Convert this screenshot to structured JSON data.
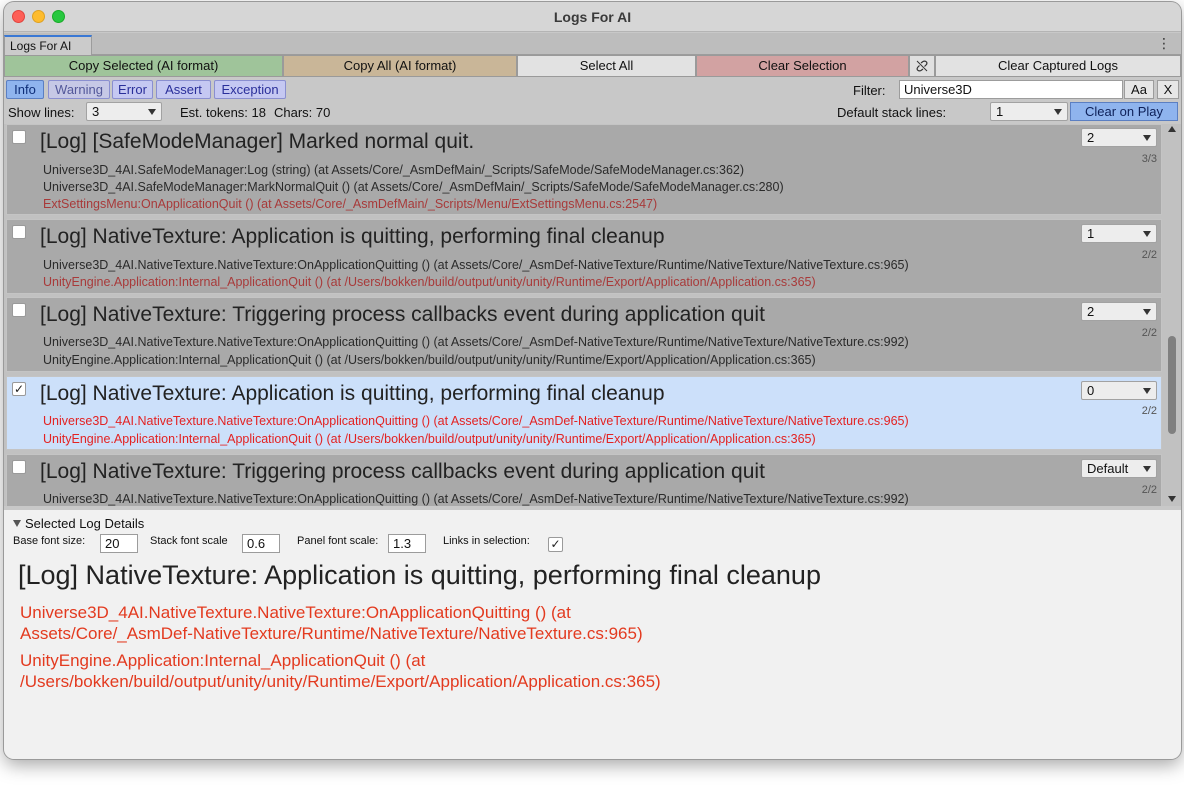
{
  "window": {
    "title": "Logs For AI"
  },
  "tab": {
    "label": "Logs For AI",
    "menu_icon": "kebab-menu-icon"
  },
  "actions": {
    "copy_selected": "Copy Selected (AI format)",
    "copy_all": "Copy All (AI format)",
    "select_all": "Select All",
    "clear_selection": "Clear Selection",
    "link_icon": "unlink-icon",
    "clear_captured": "Clear Captured Logs"
  },
  "colors": {
    "copy_selected_bg": "#9fc49a",
    "copy_all_bg": "#c9b698",
    "clear_selection_bg": "#d2a2a2",
    "accent": "#8fb4ee",
    "stack_red": "#e32222",
    "selected_row": "#cce0fa"
  },
  "levels": {
    "info": "Info",
    "warning": "Warning",
    "error": "Error",
    "assert": "Assert",
    "exception": "Exception"
  },
  "filter": {
    "label": "Filter:",
    "value": "Universe3D",
    "case_button": "Aa",
    "clear_button": "X"
  },
  "options": {
    "show_lines_label": "Show lines:",
    "show_lines_value": "3",
    "est_tokens": "Est. tokens: 18",
    "chars": "Chars: 70",
    "default_stack_label": "Default stack lines:",
    "default_stack_value": "1",
    "clear_on_play": "Clear on Play"
  },
  "logs": [
    {
      "checked": false,
      "title": "[Log] [SafeModeManager] Marked normal quit.",
      "lines_value": "2",
      "count": "3/3",
      "stack": [
        "Universe3D_4AI.SafeModeManager:Log (string) (at Assets/Core/_AsmDefMain/_Scripts/SafeMode/SafeModeManager.cs:362)",
        "Universe3D_4AI.SafeModeManager:MarkNormalQuit () (at Assets/Core/_AsmDefMain/_Scripts/SafeMode/SafeModeManager.cs:280)",
        "ExtSettingsMenu:OnApplicationQuit () (at Assets/Core/_AsmDefMain/_Scripts/Menu/ExtSettingsMenu.cs:2547)"
      ]
    },
    {
      "checked": false,
      "title": "[Log] NativeTexture: Application is quitting, performing final cleanup",
      "lines_value": "1",
      "count": "2/2",
      "stack": [
        "Universe3D_4AI.NativeTexture.NativeTexture:OnApplicationQuitting () (at Assets/Core/_AsmDef-NativeTexture/Runtime/NativeTexture/NativeTexture.cs:965)",
        "UnityEngine.Application:Internal_ApplicationQuit () (at /Users/bokken/build/output/unity/unity/Runtime/Export/Application/Application.cs:365)"
      ]
    },
    {
      "checked": false,
      "title": "[Log] NativeTexture: Triggering process callbacks event during application quit",
      "lines_value": "2",
      "count": "2/2",
      "stack": [
        "Universe3D_4AI.NativeTexture.NativeTexture:OnApplicationQuitting () (at Assets/Core/_AsmDef-NativeTexture/Runtime/NativeTexture/NativeTexture.cs:992)",
        "UnityEngine.Application:Internal_ApplicationQuit () (at /Users/bokken/build/output/unity/unity/Runtime/Export/Application/Application.cs:365)"
      ]
    },
    {
      "checked": true,
      "title": "[Log] NativeTexture: Application is quitting, performing final cleanup",
      "lines_value": "0",
      "count": "2/2",
      "stack": [
        "Universe3D_4AI.NativeTexture.NativeTexture:OnApplicationQuitting () (at Assets/Core/_AsmDef-NativeTexture/Runtime/NativeTexture/NativeTexture.cs:965)",
        "UnityEngine.Application:Internal_ApplicationQuit () (at /Users/bokken/build/output/unity/unity/Runtime/Export/Application/Application.cs:365)"
      ]
    },
    {
      "checked": false,
      "title": "[Log] NativeTexture: Triggering process callbacks event during application quit",
      "lines_value": "Default",
      "count": "2/2",
      "stack": [
        "Universe3D_4AI.NativeTexture.NativeTexture:OnApplicationQuitting () (at Assets/Core/_AsmDef-NativeTexture/Runtime/NativeTexture/NativeTexture.cs:992)"
      ]
    }
  ],
  "details": {
    "header": "Selected Log Details",
    "base_font_label": "Base font size:",
    "base_font_value": "20",
    "stack_scale_label": "Stack font scale",
    "stack_scale_value": "0.6",
    "panel_scale_label": "Panel font scale:",
    "panel_scale_value": "1.3",
    "links_label": "Links in selection:",
    "links_checked": true,
    "title": "[Log] NativeTexture: Application is quitting, performing final cleanup",
    "stack": [
      "Universe3D_4AI.NativeTexture.NativeTexture:OnApplicationQuitting () (at",
      "Assets/Core/_AsmDef-NativeTexture/Runtime/NativeTexture/NativeTexture.cs:965)",
      "UnityEngine.Application:Internal_ApplicationQuit () (at",
      "/Users/bokken/build/output/unity/unity/Runtime/Export/Application/Application.cs:365)"
    ]
  }
}
